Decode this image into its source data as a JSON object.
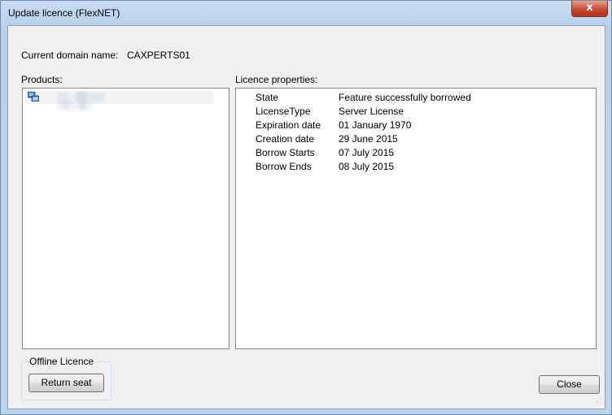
{
  "window": {
    "title": "Update licence (FlexNET)",
    "close_glyph": "x"
  },
  "domain": {
    "label": "Current domain name:",
    "value": "CAXPERTS01"
  },
  "products": {
    "label": "Products:",
    "items": [
      {
        "icon": "network-computer-icon",
        "label": "░░ · ▒▒░░░ ░▒░░▒░"
      }
    ]
  },
  "properties": {
    "label": "Licence properties:",
    "rows": [
      {
        "key": "State",
        "value": "Feature successfully borrowed"
      },
      {
        "key": "LicenseType",
        "value": "Server License"
      },
      {
        "key": "Expiration date",
        "value": "01 January 1970"
      },
      {
        "key": "Creation date",
        "value": "29 June 2015"
      },
      {
        "key": "Borrow Starts",
        "value": "07 July 2015"
      },
      {
        "key": "Borrow Ends",
        "value": "08 July 2015"
      }
    ]
  },
  "offline": {
    "group_title": "Offline Licence",
    "return_button": "Return seat"
  },
  "footer": {
    "close_button": "Close"
  },
  "colors": {
    "title_close_red": "#c74b32",
    "frame_blue": "#bcd3ed",
    "dialog_bg": "#f0f0f0"
  }
}
